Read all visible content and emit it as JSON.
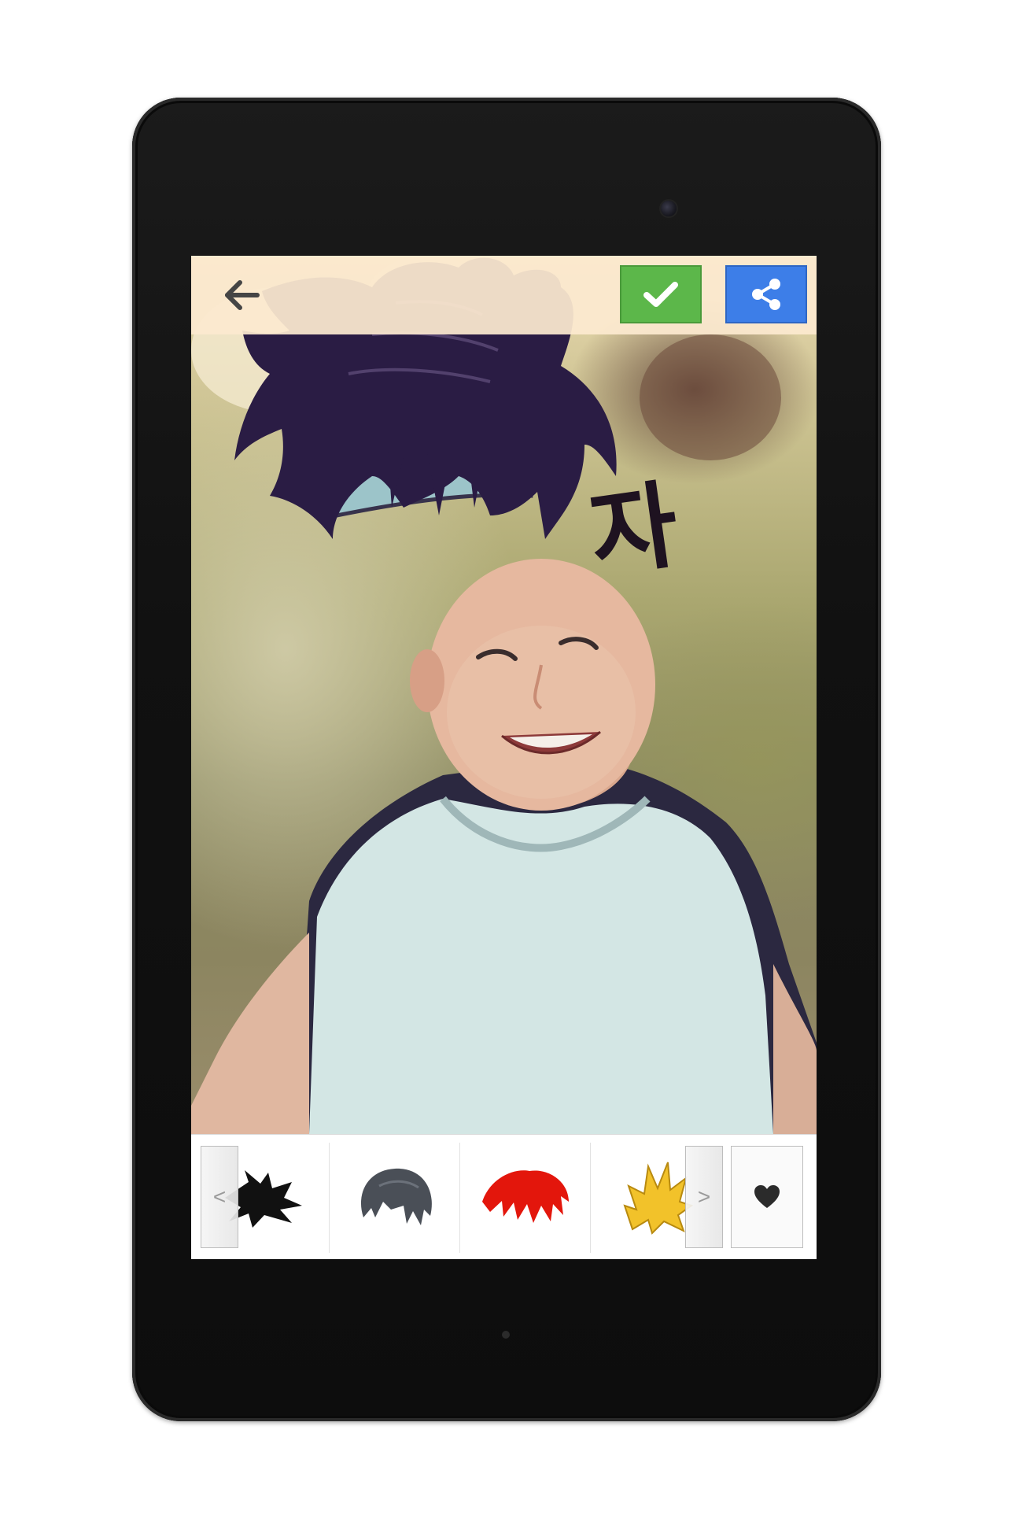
{
  "app": {
    "topbar": {
      "back_icon": "arrow-left-icon",
      "confirm_icon": "checkmark-icon",
      "share_icon": "share-icon"
    },
    "colors": {
      "confirm_button": "#5cb74a",
      "share_button": "#3d7ee8",
      "topbar_background": "#fcead0"
    },
    "photo": {
      "sticker_text": "자"
    },
    "hair_strip": {
      "prev_label": "<",
      "next_label": ">",
      "favorites_icon": "heart-icon",
      "items": [
        {
          "name": "black-spiky-hair",
          "color": "#111111"
        },
        {
          "name": "gray-messy-hair",
          "color": "#4a4f57"
        },
        {
          "name": "red-hair",
          "color": "#e3160c"
        },
        {
          "name": "golden-super-hair",
          "color": "#f2c22a"
        }
      ]
    }
  }
}
